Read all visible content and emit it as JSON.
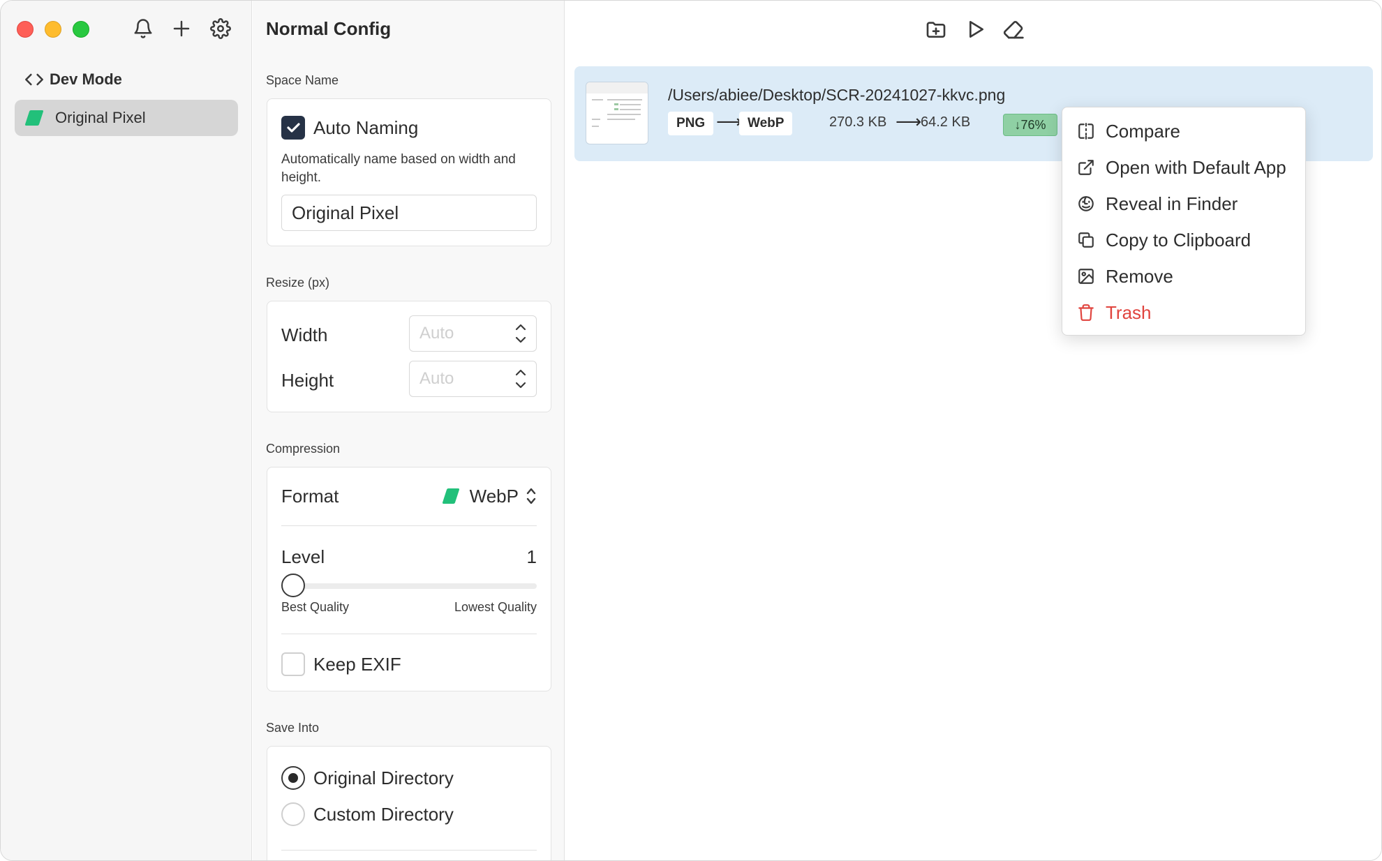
{
  "sidebar": {
    "items": [
      {
        "label": "Dev Mode",
        "icon": "code-icon"
      },
      {
        "label": "Original Pixel",
        "icon": "green-mark-icon"
      }
    ]
  },
  "config": {
    "title": "Normal Config",
    "space_name": {
      "section_label": "Space Name",
      "auto_naming_label": "Auto Naming",
      "auto_naming_checked": true,
      "auto_naming_desc": "Automatically name based on width and height.",
      "name_value": "Original Pixel"
    },
    "resize": {
      "section_label": "Resize (px)",
      "width_label": "Width",
      "width_placeholder": "Auto",
      "height_label": "Height",
      "height_placeholder": "Auto"
    },
    "compression": {
      "section_label": "Compression",
      "format_label": "Format",
      "format_value": "WebP",
      "level_label": "Level",
      "level_value": "1",
      "level_fraction": 0.0,
      "best_label": "Best Quality",
      "lowest_label": "Lowest Quality",
      "keep_exif_label": "Keep EXIF",
      "keep_exif_checked": false
    },
    "save_into": {
      "section_label": "Save Into",
      "options": [
        "Original Directory",
        "Custom Directory"
      ],
      "selected": "Original Directory"
    }
  },
  "file": {
    "path": "/Users/abiee/Desktop/SCR-20241027-kkvc.png",
    "from_format": "PNG",
    "to_format": "WebP",
    "arrow": "⟶",
    "original_size": "270.3 KB",
    "new_size": "64.2 KB",
    "reduction": "↓76%"
  },
  "context_menu": {
    "items": [
      {
        "label": "Compare",
        "icon": "compare-icon"
      },
      {
        "label": "Open with Default App",
        "icon": "external-link-icon"
      },
      {
        "label": "Reveal in Finder",
        "icon": "finder-icon"
      },
      {
        "label": "Copy to Clipboard",
        "icon": "copy-icon"
      },
      {
        "label": "Remove",
        "icon": "image-remove-icon"
      },
      {
        "label": "Trash",
        "icon": "trash-icon"
      }
    ]
  },
  "colors": {
    "accent_green": "#22c07a",
    "selection_blue": "#dcebf7",
    "danger_red": "#e0443e",
    "badge_green": "#8fd0a4"
  }
}
